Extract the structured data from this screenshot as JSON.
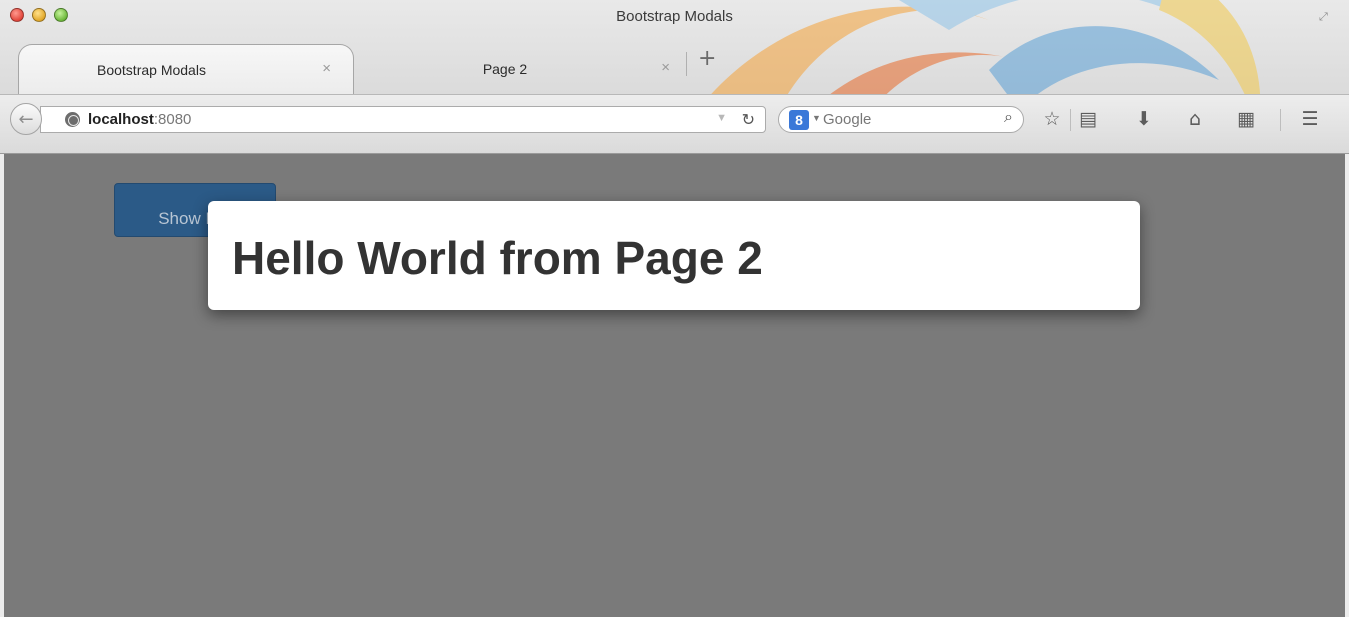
{
  "window": {
    "title": "Bootstrap Modals"
  },
  "tabs": [
    {
      "label": "Bootstrap Modals",
      "active": true,
      "close": "×"
    },
    {
      "label": "Page 2",
      "active": false,
      "close": "×"
    }
  ],
  "new_tab_label": "+",
  "navbar": {
    "url_host": "localhost",
    "url_port": ":8080",
    "reload_icon": "reload-icon",
    "search_engine_badge": "8",
    "search_placeholder": "Google"
  },
  "toolbar_icons": [
    "star-icon",
    "reading-list-icon",
    "download-icon",
    "home-icon",
    "apps-icon",
    "menu-icon"
  ],
  "page": {
    "show_modal_button": "Show Modal",
    "modal_title": "Hello World from Page 2"
  },
  "colors": {
    "backdrop": "#7a7a7a",
    "button": "#2b5a87",
    "modal_bg": "#ffffff"
  }
}
